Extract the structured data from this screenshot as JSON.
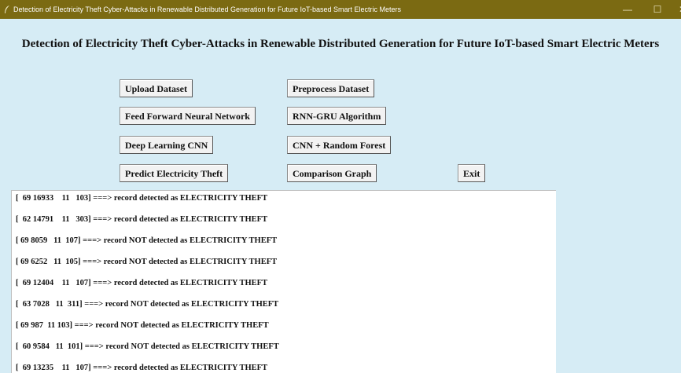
{
  "window": {
    "title": "Detection of Electricity Theft Cyber-Attacks in Renewable Distributed Generation for Future IoT-based Smart Electric Meters",
    "controls": {
      "minimize": "—",
      "maximize": "☐",
      "close": "✕"
    }
  },
  "heading": "Detection of Electricity Theft Cyber-Attacks in Renewable Distributed Generation for Future IoT-based Smart Electric Meters",
  "buttons": {
    "upload": "Upload Dataset",
    "preprocess": "Preprocess Dataset",
    "ffnn": "Feed Forward Neural Network",
    "rnn_gru": "RNN-GRU Algorithm",
    "cnn": "Deep Learning CNN",
    "cnn_rf": "CNN + Random Forest",
    "predict": "Predict Electricity Theft",
    "comparison": "Comparison Graph",
    "exit": "Exit"
  },
  "output_lines": [
    "[  69 16933    11   103] ===> record detected as ELECTRICITY THEFT",
    "[  62 14791    11   303] ===> record detected as ELECTRICITY THEFT",
    "[ 69 8059   11  107] ===> record NOT detected as ELECTRICITY THEFT",
    "[ 69 6252   11  105] ===> record NOT detected as ELECTRICITY THEFT",
    "[  69 12404    11   107] ===> record detected as ELECTRICITY THEFT",
    "[  63 7028   11  311] ===> record NOT detected as ELECTRICITY THEFT",
    "[ 69 987  11 103] ===> record NOT detected as ELECTRICITY THEFT",
    "[  60 9584   11  101] ===> record NOT detected as ELECTRICITY THEFT",
    "[  69 13235    11   107] ===> record detected as ELECTRICITY THEFT"
  ],
  "colors": {
    "titlebar": "#7b6a12",
    "background": "#d6ecf5"
  },
  "icons": {
    "app": "feather-icon"
  }
}
